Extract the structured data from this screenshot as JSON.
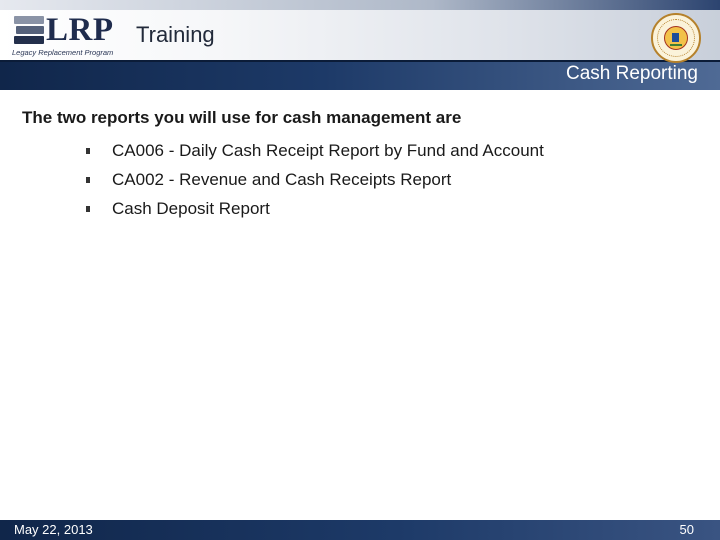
{
  "header": {
    "logo": {
      "letters": "LRP",
      "caption": "Legacy Replacement Program",
      "icon": "book-stack-logo"
    },
    "title": "Training",
    "section_title": "Cash Reporting",
    "seal_icon": "county-seal",
    "colors": {
      "bar_dark": "#1d3a68",
      "accent_gold": "#b5812b"
    }
  },
  "main": {
    "lead": "The two reports you will use for cash management are",
    "bullets": [
      {
        "text": "CA006 - Daily Cash Receipt Report by Fund and Account"
      },
      {
        "text": "CA002 - Revenue and Cash Receipts Report"
      },
      {
        "text": "Cash Deposit Report"
      }
    ]
  },
  "footer": {
    "date": "May 22, 2013",
    "page_number": "50"
  }
}
